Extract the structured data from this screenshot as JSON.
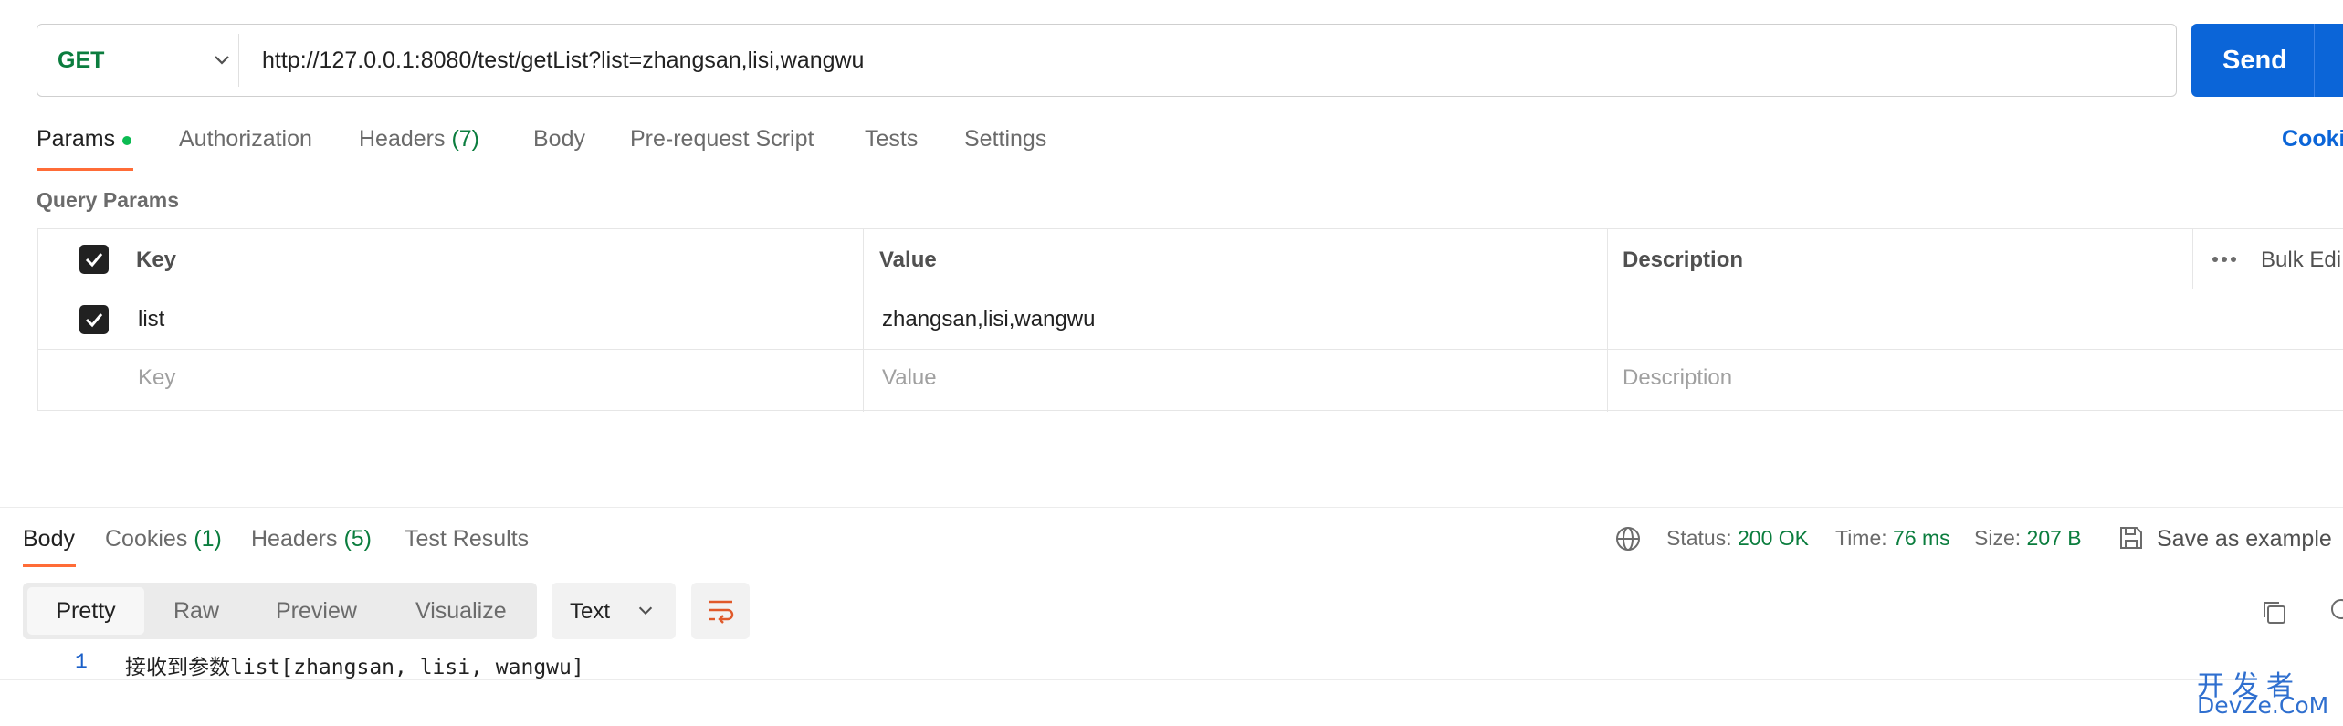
{
  "request": {
    "method": "GET",
    "url": "http://127.0.0.1:8080/test/getList?list=zhangsan,lisi,wangwu",
    "send_label": "Send"
  },
  "request_tabs": {
    "params": "Params",
    "authorization": "Authorization",
    "headers": "Headers",
    "headers_count": "(7)",
    "body": "Body",
    "pre_request": "Pre-request Script",
    "tests": "Tests",
    "settings": "Settings",
    "cookies_link": "Cooki"
  },
  "query_params": {
    "title": "Query Params",
    "headers": {
      "key": "Key",
      "value": "Value",
      "description": "Description",
      "bulk_edit": "Bulk Edi"
    },
    "rows": [
      {
        "key": "list",
        "value": "zhangsan,lisi,wangwu",
        "description": "",
        "checked": true
      }
    ],
    "placeholders": {
      "key": "Key",
      "value": "Value",
      "description": "Description"
    }
  },
  "response": {
    "tabs": {
      "body": "Body",
      "cookies": "Cookies",
      "cookies_count": "(1)",
      "headers": "Headers",
      "headers_count": "(5)",
      "test_results": "Test Results"
    },
    "status_label": "Status:",
    "status_value": "200 OK",
    "time_label": "Time:",
    "time_value": "76 ms",
    "size_label": "Size:",
    "size_value": "207 B",
    "save_example": "Save as example",
    "view_modes": [
      "Pretty",
      "Raw",
      "Preview",
      "Visualize"
    ],
    "format": "Text",
    "lines": [
      {
        "no": "1",
        "text": "接收到参数list[zhangsan, lisi, wangwu]"
      }
    ]
  },
  "watermark": {
    "top": "开发者",
    "bottom": "DevZe.CoM"
  },
  "colors": {
    "accent_orange": "#ff6c37",
    "send_blue": "#0b65d8",
    "success_green": "#0b7d3e",
    "dot_green": "#0cbb52"
  }
}
